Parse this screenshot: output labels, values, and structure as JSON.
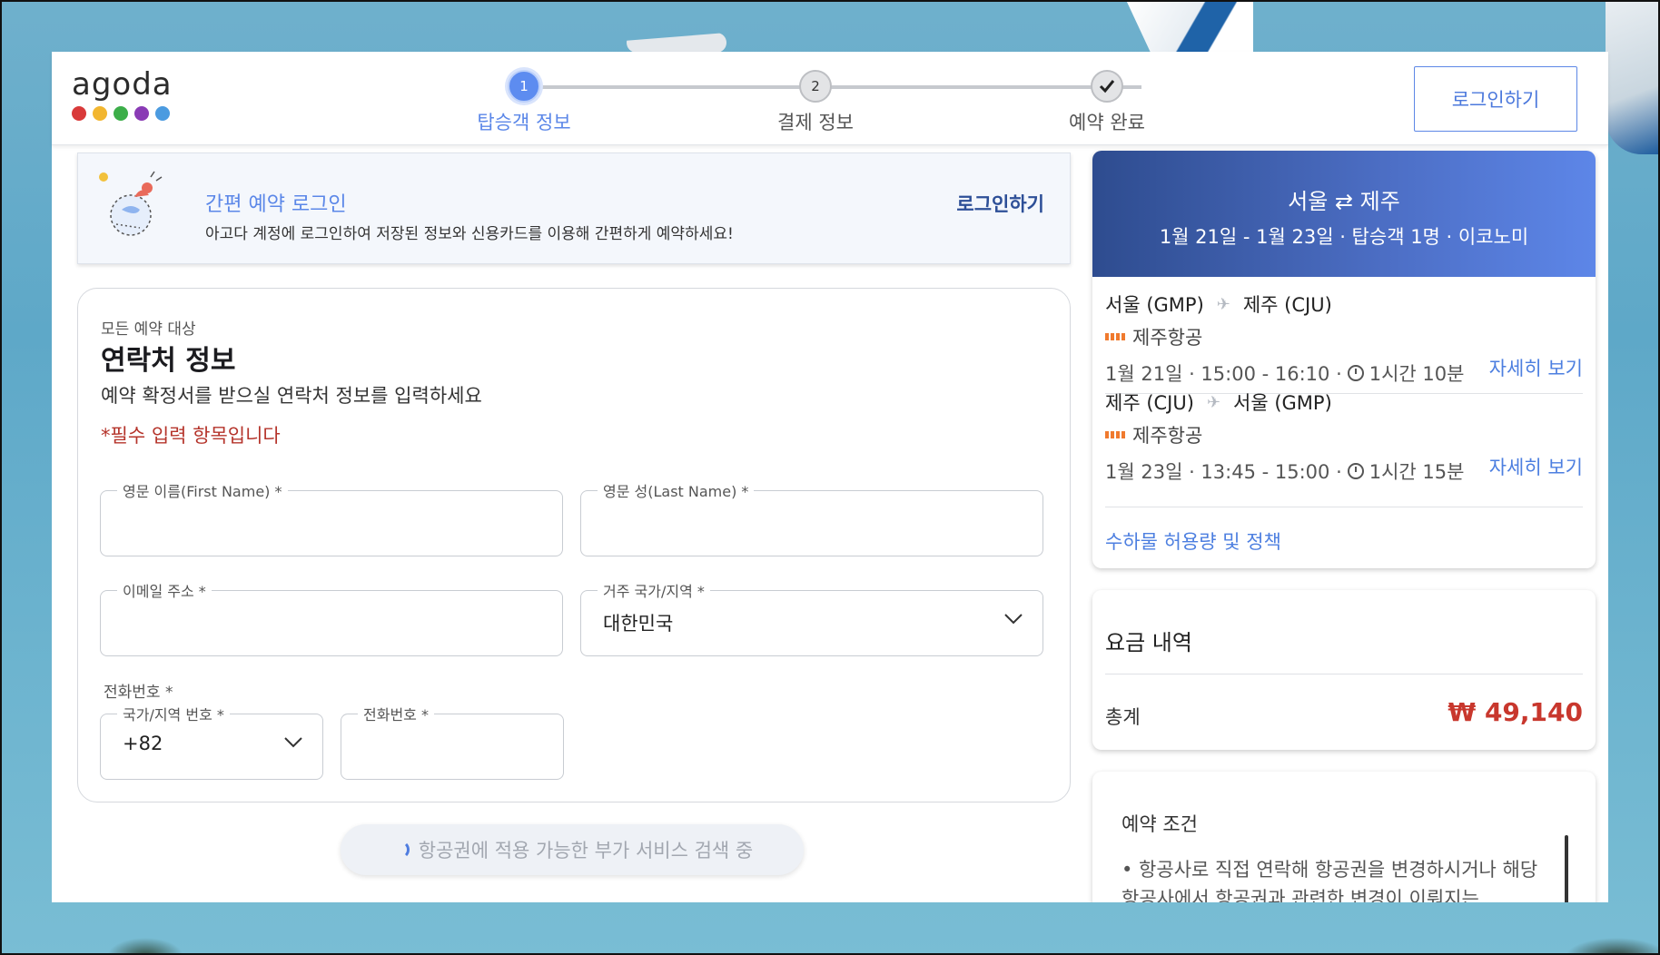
{
  "header": {
    "logo_text": "agoda",
    "logo_dot_colors": [
      "#d93a3a",
      "#f2b630",
      "#3cae49",
      "#8a3bb5",
      "#4b9be0"
    ],
    "login_button": "로그인하기",
    "steps": [
      {
        "number": "1",
        "label": "탑승객 정보",
        "state": "active"
      },
      {
        "number": "2",
        "label": "결제 정보",
        "state": "pending"
      },
      {
        "number": "",
        "label": "예약 완료",
        "state": "pending",
        "icon": "check-icon"
      }
    ]
  },
  "banner": {
    "title": "간편 예약 로그인",
    "description": "아고다 계정에 로그인하여 저장된 정보와 신용카드를 이용해 간편하게 예약하세요!",
    "login_link": "로그인하기"
  },
  "contact": {
    "subtitle": "모든 예약 대상",
    "title": "연락처 정보",
    "description": "예약 확정서를 받으실 연락처 정보를 입력하세요",
    "required_note": "*필수 입력 항목입니다",
    "fields": {
      "first_name": {
        "label": "영문 이름(First Name) *",
        "value": ""
      },
      "last_name": {
        "label": "영문 성(Last Name) *",
        "value": ""
      },
      "email": {
        "label": "이메일 주소 *",
        "value": ""
      },
      "country": {
        "label": "거주 국가/지역 *",
        "value": "대한민국"
      },
      "phone_heading": "전화번호 *",
      "phone_code": {
        "label": "국가/지역 번호 *",
        "value": "+82"
      },
      "phone_number": {
        "label": "전화번호 *",
        "value": ""
      }
    },
    "loading_text": "항공권에 적용 가능한 부가 서비스 검색 중"
  },
  "flight": {
    "route": "서울 ⇄ 제주",
    "summary": "1월 21일 - 1월 23일 · 탑승객 1명 · 이코노미",
    "segments": [
      {
        "from": "서울 (GMP)",
        "to": "제주 (CJU)",
        "airline": "제주항공",
        "date_time": "1월 21일 · 15:00 - 16:10 ·",
        "duration": "1시간 10분",
        "detail_link": "자세히 보기"
      },
      {
        "from": "제주 (CJU)",
        "to": "서울 (GMP)",
        "airline": "제주항공",
        "date_time": "1월 23일 · 13:45 - 15:00 ·",
        "duration": "1시간 15분",
        "detail_link": "자세히 보기"
      }
    ],
    "baggage_link": "수하물 허용량 및 정책"
  },
  "price": {
    "title": "요금 내역",
    "total_label": "총계",
    "total_value": "₩ 49,140",
    "total_color": "#c8372d"
  },
  "terms": {
    "title": "예약 조건",
    "body": "• 항공사로 직접 연락해 항공권을 변경하시거나 해당 항공사에서 항공권과 관련한 변경이 이뤄지는"
  }
}
